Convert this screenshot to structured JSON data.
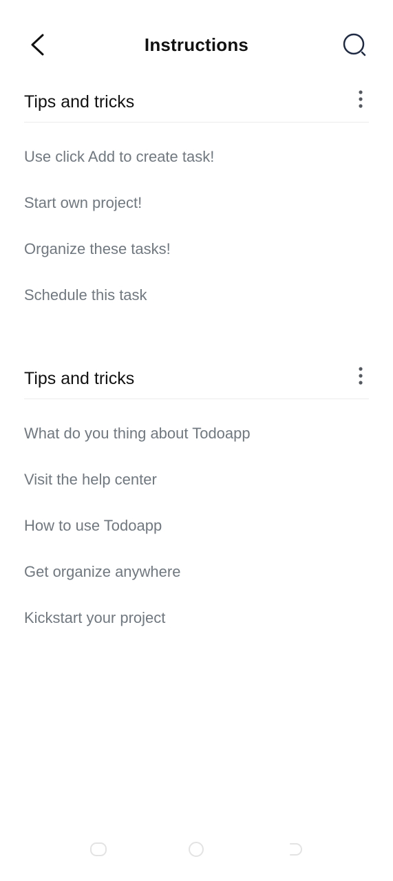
{
  "header": {
    "title": "Instructions",
    "back_icon": "chevron-left-icon",
    "search_icon": "search-icon"
  },
  "sections": [
    {
      "title": "Tips and tricks",
      "menu_icon": "more-vertical-icon",
      "items": [
        "Use click Add to create task!",
        "Start own project!",
        "Organize these tasks!",
        "Schedule this task"
      ]
    },
    {
      "title": "Tips and tricks",
      "menu_icon": "more-vertical-icon",
      "items": [
        "What do you thing about Todoapp",
        "Visit the help center",
        "How to use Todoapp",
        "Get organize anywhere",
        "Kickstart your project"
      ]
    }
  ],
  "navbar": {
    "icons": [
      "recents-icon",
      "home-icon",
      "back-nav-icon"
    ]
  },
  "colors": {
    "title": "#111111",
    "item_text": "#707880",
    "divider": "#ebebeb",
    "search_icon": "#1f2a44",
    "nav_icons": "#e6e6e6"
  }
}
